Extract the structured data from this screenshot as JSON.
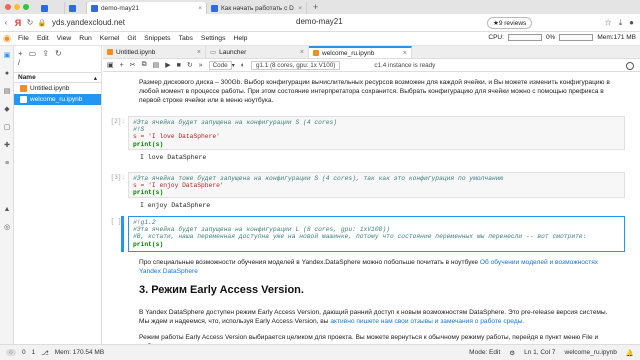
{
  "browser": {
    "tabs": [
      {
        "label": "demo-may21",
        "active": true,
        "color": "#2d6cdf"
      },
      {
        "label": "Как начать работать с D",
        "active": false,
        "color": "#2d6cdf"
      }
    ],
    "url_host": "yds.yandexcloud.net",
    "page_title": "demo-may21",
    "reviews": "★9 reviews"
  },
  "menu": [
    "File",
    "Edit",
    "View",
    "Run",
    "Kernel",
    "Git",
    "Snippets",
    "Tabs",
    "Settings",
    "Help"
  ],
  "cpu": {
    "label": "CPU:",
    "value": "0%",
    "mem": "Mem:171 MB"
  },
  "filebrowser": {
    "path": "/",
    "header_name": "Name",
    "files": [
      {
        "name": "Untitled.ipynb",
        "selected": false
      },
      {
        "name": "welcome_ru.ipynb",
        "selected": true
      }
    ]
  },
  "doc_tabs": [
    {
      "label": "Untitled.ipynb",
      "active": false
    },
    {
      "label": "Launcher",
      "active": false
    },
    {
      "label": "welcome_ru.ipynb",
      "active": true
    }
  ],
  "nb_toolbar": {
    "cell_type": "Code",
    "instance": "g1.1 (8 cores, gpu: 1x V100)",
    "status": "c1.4 instance is ready"
  },
  "content": {
    "para1": "Размер дискового диска – 300Gb. Выбор конфигурации вычислительных ресурсов возможен для каждой ячейки, и Вы можете изменить конфигурацию в любой момент в процессе работы. При этом состояние интерпретатора сохранится. Выбрать конфигурацию для ячейки можно с помощью префикса в первой строке ячейки или в меню ноутбука.",
    "cell1_prompt": "[2]:",
    "cell1": [
      "#Эта ячейка будет запущена на конфигурации S (4 cores)",
      "#!S",
      "s = 'I love DataSphere'",
      "print(s)"
    ],
    "out1": "I love DataSphere",
    "cell2_prompt": "[3]:",
    "cell2": [
      "#Эта ячейка тоже будет запущена на конфигурации S (4 cores), так как это конфигурация по умолчанию",
      "s = 'I enjoy DataSphere'",
      "print(s)"
    ],
    "out2": "I enjoy DataSphere",
    "cell3_prompt": "[ ]:",
    "cell3": [
      "#!g1.2",
      "#Эта ячейка будет запущена на конфигурации L (8 cores, gpu: 1xV100))",
      "#В, кстати, наша переменная доступна уже на новой машинке, потому что состояние переменных мы перенесли -- вот смотрите:",
      "print(s)"
    ],
    "para2_text": "Про специальные возможности обучения моделей в Yandex.DataSphere можно побольше почитать в ноутбуке ",
    "para2_link": "Об обучении моделей и возможностях Yandex DataSphere",
    "heading": "3. Режим Early Access Version.",
    "para3_text": "В Yandex DataSphere доступен режим Early Access Version, дающий ранний доступ к новым возможностям DataSphere. Это pre-release версия системы. Мы ждем и надеемся, что, используя Early Access Version, вы ",
    "para3_link": "активно пишете нам свои отзывы и замечания о работе среды.",
    "para4": "Режим работы Early Access Version выбирается целиком для проекта. Вы можете вернуться к обычному режиму работы, перейдя в пункт меню File и выбрав"
  },
  "status": {
    "zero1": "0",
    "zero2": "1",
    "mem": "Mem: 170.54 MB",
    "mode": "Mode: Edit",
    "position": "Ln 1, Col 7",
    "file": "welcome_ru.ipynb"
  }
}
